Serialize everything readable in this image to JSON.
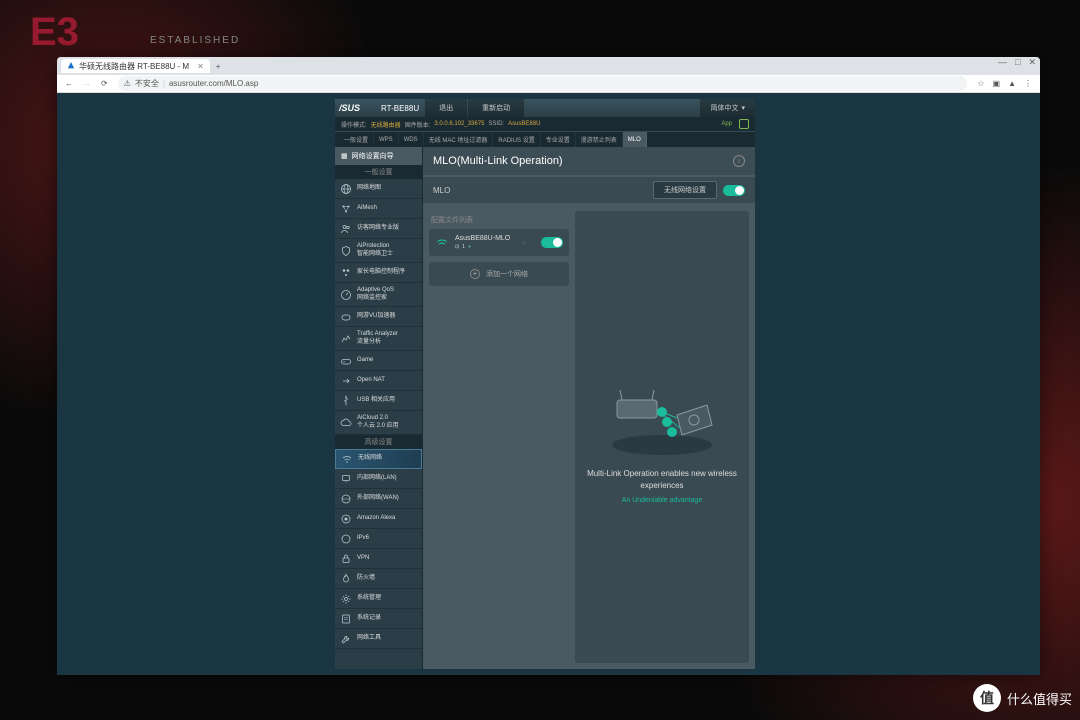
{
  "browser": {
    "tab_title": "华硕无线路由器 RT-BE88U - M",
    "security": "不安全",
    "url": "asusrouter.com/MLO.asp"
  },
  "header": {
    "brand": "/SUS",
    "model": "RT-BE88U",
    "logout": "退出",
    "reboot": "重新启动",
    "language": "简体中文"
  },
  "info": {
    "mode_label": "操作模式:",
    "mode_value": "无线路由器",
    "fw_label": "固件版本:",
    "fw_value": "3.0.0.6.102_33675",
    "ssid_label": "SSID:",
    "ssid_value": "AsusBE88U",
    "app": "App"
  },
  "tabs": [
    "一般设置",
    "WPS",
    "WDS",
    "无线 MAC 地址过滤器",
    "RADIUS 设置",
    "专业设置",
    "漫游禁止列表",
    "MLO"
  ],
  "sidebar": {
    "quick": "网络设置向导",
    "section1": "一般设置",
    "items1": [
      {
        "label": "网络地图",
        "icon": "globe"
      },
      {
        "label": "AiMesh",
        "icon": "mesh"
      },
      {
        "label": "访客网络专业版",
        "icon": "guest"
      },
      {
        "label": "AiProtection\n智能网络卫士",
        "icon": "shield"
      },
      {
        "label": "家长电脑控制程序",
        "icon": "parent"
      },
      {
        "label": "Adaptive QoS\n网络监控家",
        "icon": "qos"
      },
      {
        "label": "网游VU加速器",
        "icon": "game1"
      },
      {
        "label": "Traffic Analyzer\n流量分析",
        "icon": "traffic"
      },
      {
        "label": "Game",
        "icon": "game2"
      },
      {
        "label": "Open NAT",
        "icon": "nat"
      },
      {
        "label": "USB 相关应用",
        "icon": "usb"
      },
      {
        "label": "AiCloud 2.0\n个人云 2.0 应用",
        "icon": "cloud"
      }
    ],
    "section2": "高级设置",
    "items2": [
      {
        "label": "无线网络",
        "icon": "wifi",
        "active": true
      },
      {
        "label": "内部网络(LAN)",
        "icon": "lan"
      },
      {
        "label": "外部网络(WAN)",
        "icon": "wan"
      },
      {
        "label": "Amazon Alexa",
        "icon": "alexa"
      },
      {
        "label": "IPv6",
        "icon": "ipv6"
      },
      {
        "label": "VPN",
        "icon": "vpn"
      },
      {
        "label": "防火墙",
        "icon": "fire"
      },
      {
        "label": "系统管理",
        "icon": "admin"
      },
      {
        "label": "系统记录",
        "icon": "log"
      },
      {
        "label": "网络工具",
        "icon": "tool"
      }
    ]
  },
  "panel": {
    "title": "MLO(Multi-Link Operation)",
    "mlo": "MLO",
    "wireless_btn": "无线网络设置",
    "list_head": "配置文件列表",
    "profile_name": "AsusBE88U-MLO",
    "profile_sub": "1",
    "add_network": "添加一个网络",
    "desc": "Multi-Link Operation enables new wireless experiences",
    "advantage": "An Undeniable advantage"
  },
  "watermark": {
    "badge": "值",
    "text": "什么值得买"
  }
}
